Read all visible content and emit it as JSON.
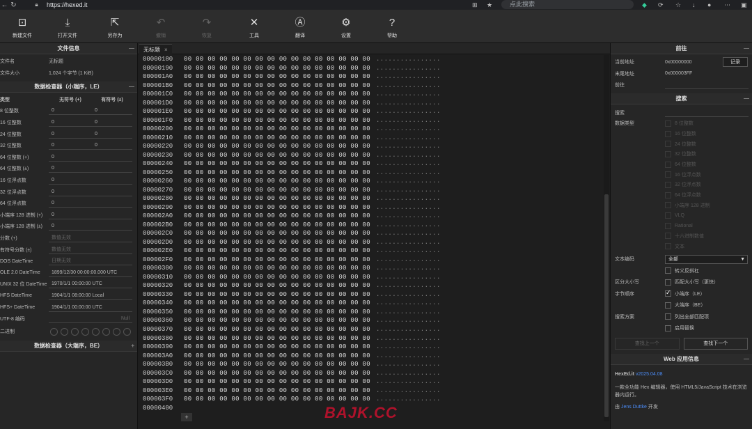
{
  "browser": {
    "url": "https://hexed.it",
    "search_placeholder": "点此搜索"
  },
  "toolbar": [
    {
      "label": "新建文件",
      "icon": "new-file-icon",
      "glyph": "⊡",
      "enabled": true
    },
    {
      "label": "打开文件",
      "icon": "open-file-icon",
      "glyph": "⤓",
      "enabled": true
    },
    {
      "label": "另存为",
      "icon": "save-as-icon",
      "glyph": "⇱",
      "enabled": true
    },
    {
      "label": "撤销",
      "icon": "undo-icon",
      "glyph": "↶",
      "enabled": false
    },
    {
      "label": "恢复",
      "icon": "redo-icon",
      "glyph": "↷",
      "enabled": false
    },
    {
      "label": "工具",
      "icon": "tools-icon",
      "glyph": "✕",
      "enabled": true
    },
    {
      "label": "翻译",
      "icon": "translate-icon",
      "glyph": "Ⓐ",
      "enabled": true
    },
    {
      "label": "设置",
      "icon": "gear-icon",
      "glyph": "⚙",
      "enabled": true
    },
    {
      "label": "帮助",
      "icon": "help-icon",
      "glyph": "?",
      "enabled": true
    }
  ],
  "file_info": {
    "title": "文件信息",
    "name_label": "文件名",
    "name_value": "无标题",
    "size_label": "文件大小",
    "size_value": "1,024 个字节 (1 KiB)"
  },
  "inspector_le": {
    "title": "数据检查器（小端序，LE）",
    "col_type": "类型",
    "col_unsigned": "无符号 (+)",
    "col_signed": "有符号 (±)",
    "rows2": [
      {
        "label": "8 位整数",
        "u": "0",
        "s": "0"
      },
      {
        "label": "16 位整数",
        "u": "0",
        "s": "0"
      },
      {
        "label": "24 位整数",
        "u": "0",
        "s": "0"
      },
      {
        "label": "32 位整数",
        "u": "0",
        "s": "0"
      }
    ],
    "rows1": [
      {
        "label": "64 位整数 (+)",
        "v": "0",
        "ph": false
      },
      {
        "label": "64 位整数 (±)",
        "v": "0",
        "ph": false
      },
      {
        "label": "16 位浮点数",
        "v": "0",
        "ph": false
      },
      {
        "label": "32 位浮点数",
        "v": "0",
        "ph": false
      },
      {
        "label": "64 位浮点数",
        "v": "0",
        "ph": false
      },
      {
        "label": "小端序 128 进制 (+)",
        "v": "0",
        "ph": false
      },
      {
        "label": "小端序 128 进制 (±)",
        "v": "0",
        "ph": false
      },
      {
        "label": "分数 (+)",
        "v": "数值无效",
        "ph": true
      },
      {
        "label": "有符号分数 (±)",
        "v": "数值无效",
        "ph": true
      },
      {
        "label": "DOS DateTime",
        "v": "日期无效",
        "ph": true
      },
      {
        "label": "OLE 2.0 DateTime",
        "v": "1899/12/30 00:00:00.000 UTC",
        "ph": false
      },
      {
        "label": "UNIX 32 位 DateTime",
        "v": "1970/1/1 00:00:00 UTC",
        "ph": false
      },
      {
        "label": "HFS DateTime",
        "v": "1904/1/1 08:00:00 Local",
        "ph": false
      },
      {
        "label": "HFS+ DateTime",
        "v": "1904/1/1 00:00:00 UTC",
        "ph": false
      }
    ],
    "utf8_label": "UTF-8 编码",
    "utf8_value": "Null",
    "binary_label": "二进制"
  },
  "inspector_be": {
    "title": "数据检查器（大端序，BE）"
  },
  "editor": {
    "tab_title": "无标题",
    "offsets": [
      "00000180",
      "00000190",
      "000001A0",
      "000001B0",
      "000001C0",
      "000001D0",
      "000001E0",
      "000001F0",
      "00000200",
      "00000210",
      "00000220",
      "00000230",
      "00000240",
      "00000250",
      "00000260",
      "00000270",
      "00000280",
      "00000290",
      "000002A0",
      "000002B0",
      "000002C0",
      "000002D0",
      "000002E0",
      "000002F0",
      "00000300",
      "00000310",
      "00000320",
      "00000330",
      "00000340",
      "00000350",
      "00000360",
      "00000370",
      "00000380",
      "00000390",
      "000003A0",
      "000003B0",
      "000003C0",
      "000003D0",
      "000003E0",
      "000003F0",
      "00000400"
    ],
    "bytes_row": "00 00 00 00 00 00 00 00 00 00 00 00 00 00 00 00",
    "text_row": "................",
    "watermark": "BAJK.CC"
  },
  "goto": {
    "title": "前往",
    "current_label": "当前地址",
    "current_value": "0x00000000",
    "record_button": "记录",
    "end_label": "末尾地址",
    "end_value": "0x000003FF",
    "goto_label": "前往"
  },
  "search": {
    "title": "搜索",
    "search_label": "搜索",
    "datatype_label": "数据类型",
    "types": [
      "8 位整数",
      "16 位整数",
      "24 位整数",
      "32 位整数",
      "64 位整数",
      "16 位浮点数",
      "32 位浮点数",
      "64 位浮点数",
      "小端序 128 进制",
      "VLQ",
      "Rational",
      "十六进制数值",
      "文本"
    ],
    "encoding_label": "文本编码",
    "encoding_value": "全部",
    "escape_label": "转义反斜杠",
    "case_label": "区分大小写",
    "case_option": "匹配大小写（更快）",
    "endian_label": "字节顺序",
    "little_endian": "小端序（LE）",
    "big_endian": "大端序（BE）",
    "plan_label": "搜索方案",
    "list_all": "列出全部匹配项",
    "enable_replace": "启用替换",
    "prev_button": "查找上一个",
    "next_button": "查找下一个"
  },
  "app_info": {
    "title": "Web 应用信息",
    "name": "HexEd.it",
    "version": "v2025.04.08",
    "desc": "一款全功能 Hex 编辑器，使用 HTML5/JavaScript 技术在浏览器内运行。",
    "by_prefix": "由",
    "author": "Jens Duttke",
    "by_suffix": "开发"
  }
}
